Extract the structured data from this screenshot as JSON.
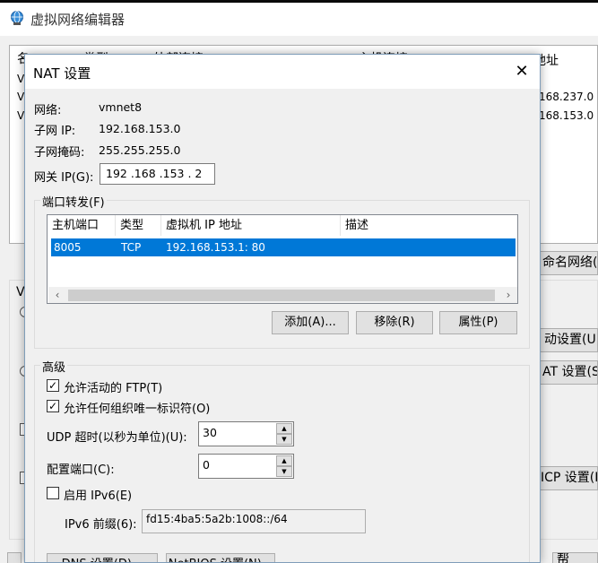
{
  "background_window": {
    "title": "虚拟网络编辑器",
    "headers": [
      "名",
      "类型",
      "外部连接",
      "主机连接",
      "子网地址"
    ],
    "rows_prefix": [
      "V",
      "V",
      "V"
    ],
    "subnet_values": [
      "168.237.0",
      "168.153.0"
    ],
    "rename_button": "命名网络(",
    "auto_setting_button": "动设置(U)",
    "nat_setting_button": "AT 设置(S)",
    "dhcp_setting_button": "ICP 设置(P)",
    "bottom_right_button": "帮"
  },
  "dialog": {
    "title": "NAT 设置",
    "network_label": "网络:",
    "network_value": "vmnet8",
    "subnet_ip_label": "子网 IP:",
    "subnet_ip_value": "192.168.153.0",
    "subnet_mask_label": "子网掩码:",
    "subnet_mask_value": "255.255.255.0",
    "gateway_label": "网关 IP(G):",
    "gateway_value": "192 .168 .153 .  2",
    "port_forwarding": {
      "group_title": "端口转发(F)",
      "columns": [
        "主机端口",
        "类型",
        "虚拟机 IP 地址",
        "描述"
      ],
      "rows": [
        {
          "host_port": "8005",
          "type": "TCP",
          "vm_ip": "192.168.153.1: 80",
          "description": ""
        }
      ],
      "add_button": "添加(A)...",
      "remove_button": "移除(R)",
      "properties_button": "属性(P)"
    },
    "advanced": {
      "group_title": "高级",
      "allow_ftp_label": "允许活动的 FTP(T)",
      "allow_ftp_checked": true,
      "allow_oui_label": "允许任何组织唯一标识符(O)",
      "allow_oui_checked": true,
      "udp_timeout_label": "UDP 超时(以秒为单位)(U):",
      "udp_timeout_value": "30",
      "config_port_label": "配置端口(C):",
      "config_port_value": "0",
      "enable_ipv6_label": "启用 IPv6(E)",
      "enable_ipv6_checked": false,
      "ipv6_prefix_label": "IPv6 前缀(6):",
      "ipv6_prefix_value": "fd15:4ba5:5a2b:1008::/64"
    },
    "dns_button": "DNS 设置(D)...",
    "netbios_button": "NetBIOS 设置(N)..."
  }
}
